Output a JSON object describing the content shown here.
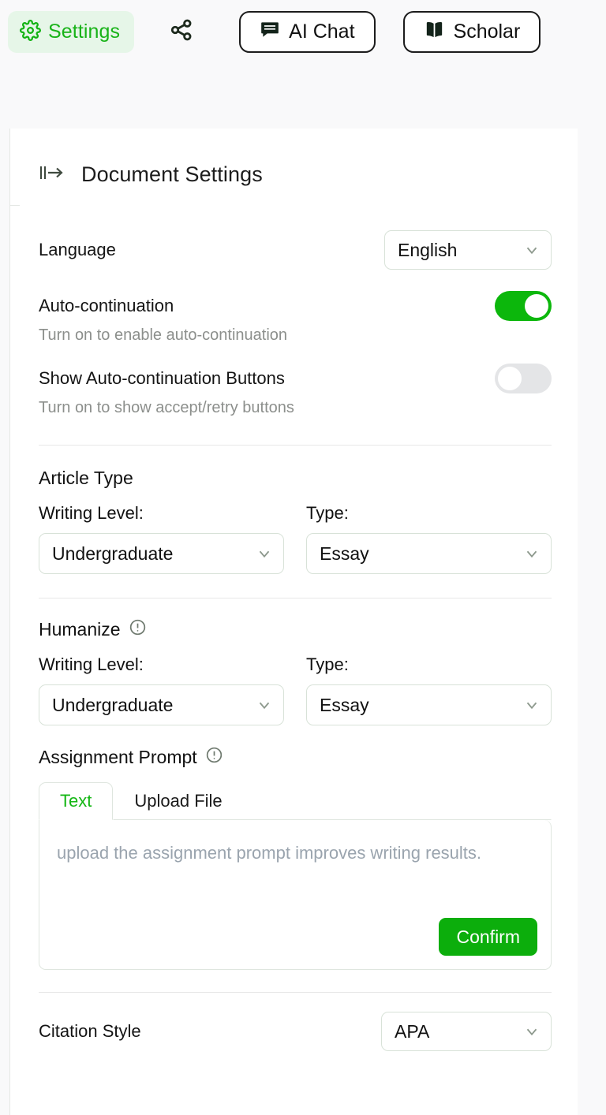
{
  "toolbar": {
    "settings_label": "Settings",
    "settings_icon": "gear-icon",
    "share_icon": "share-nodes-icon",
    "buttons": [
      {
        "label": "AI Chat",
        "icon": "chat-bubble-icon"
      },
      {
        "label": "Scholar",
        "icon": "open-book-icon"
      }
    ]
  },
  "panel": {
    "collapse_icon": "panel-collapse-right-icon",
    "title": "Document Settings",
    "language": {
      "label": "Language",
      "value": "English",
      "options": [
        "English"
      ]
    },
    "auto_continuation": {
      "label": "Auto-continuation",
      "hint": "Turn on to enable auto-continuation",
      "state": "on"
    },
    "show_buttons": {
      "label": "Show Auto-continuation Buttons",
      "hint": "Turn on to show accept/retry buttons",
      "state": "off"
    },
    "article_type": {
      "title": "Article Type",
      "writing_level_label": "Writing Level:",
      "writing_level_value": "Undergraduate",
      "type_label": "Type:",
      "type_value": "Essay"
    },
    "humanize": {
      "title": "Humanize",
      "info_icon": "info-circle-icon",
      "writing_level_label": "Writing Level:",
      "writing_level_value": "Undergraduate",
      "type_label": "Type:",
      "type_value": "Essay"
    },
    "assignment_prompt": {
      "title": "Assignment Prompt",
      "info_icon": "info-circle-icon",
      "tabs": [
        {
          "label": "Text",
          "active": true
        },
        {
          "label": "Upload File",
          "active": false
        }
      ],
      "placeholder": "upload the assignment prompt improves writing results.",
      "confirm_label": "Confirm"
    },
    "citation_style": {
      "label": "Citation Style",
      "value": "APA",
      "options": [
        "APA"
      ]
    }
  },
  "colors": {
    "accent_green": "#0cae0c",
    "settings_bg": "#e6f6e8",
    "toggle_on": "#0cb70c",
    "toggle_off": "#e4e5e7",
    "page_bg": "#f9f9fa"
  }
}
